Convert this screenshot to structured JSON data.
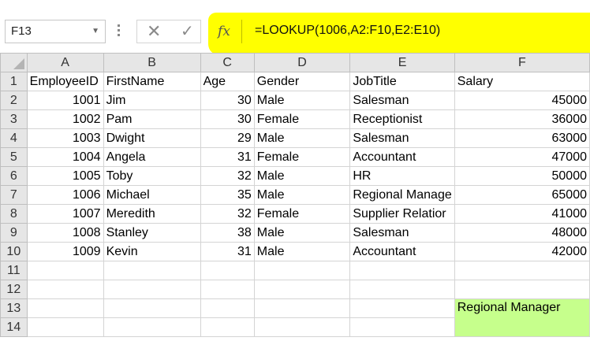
{
  "formula_bar": {
    "name_box": "F13",
    "fx_label": "fx",
    "formula": "=LOOKUP(1006,A2:F10,E2:E10)",
    "highlight_color": "#ffff00"
  },
  "columns": [
    "A",
    "B",
    "C",
    "D",
    "E",
    "F"
  ],
  "rows": [
    {
      "n": "1",
      "cells": [
        "EmployeeID",
        "FirstName",
        "Age",
        "Gender",
        "JobTitle",
        "Salary"
      ]
    },
    {
      "n": "2",
      "cells": [
        "1001",
        "Jim",
        "30",
        "Male",
        "Salesman",
        "45000"
      ]
    },
    {
      "n": "3",
      "cells": [
        "1002",
        "Pam",
        "30",
        "Female",
        "Receptionist",
        "36000"
      ]
    },
    {
      "n": "4",
      "cells": [
        "1003",
        "Dwight",
        "29",
        "Male",
        "Salesman",
        "63000"
      ]
    },
    {
      "n": "5",
      "cells": [
        "1004",
        "Angela",
        "31",
        "Female",
        "Accountant",
        "47000"
      ]
    },
    {
      "n": "6",
      "cells": [
        "1005",
        "Toby",
        "32",
        "Male",
        "HR",
        "50000"
      ]
    },
    {
      "n": "7",
      "cells": [
        "1006",
        "Michael",
        "35",
        "Male",
        "Regional Manage",
        "65000"
      ]
    },
    {
      "n": "8",
      "cells": [
        "1007",
        "Meredith",
        "32",
        "Female",
        "Supplier Relatior",
        "41000"
      ]
    },
    {
      "n": "9",
      "cells": [
        "1008",
        "Stanley",
        "38",
        "Male",
        "Salesman",
        "48000"
      ]
    },
    {
      "n": "10",
      "cells": [
        "1009",
        "Kevin",
        "31",
        "Male",
        "Accountant",
        "42000"
      ]
    },
    {
      "n": "11",
      "cells": [
        "",
        "",
        "",
        "",
        "",
        ""
      ]
    },
    {
      "n": "12",
      "cells": [
        "",
        "",
        "",
        "",
        "",
        ""
      ]
    },
    {
      "n": "13",
      "cells": [
        "",
        "",
        "",
        "",
        "",
        "Regional Manager"
      ]
    },
    {
      "n": "14",
      "cells": [
        "",
        "",
        "",
        "",
        "",
        ""
      ]
    }
  ],
  "result_cell_color": "#c6ff8c"
}
